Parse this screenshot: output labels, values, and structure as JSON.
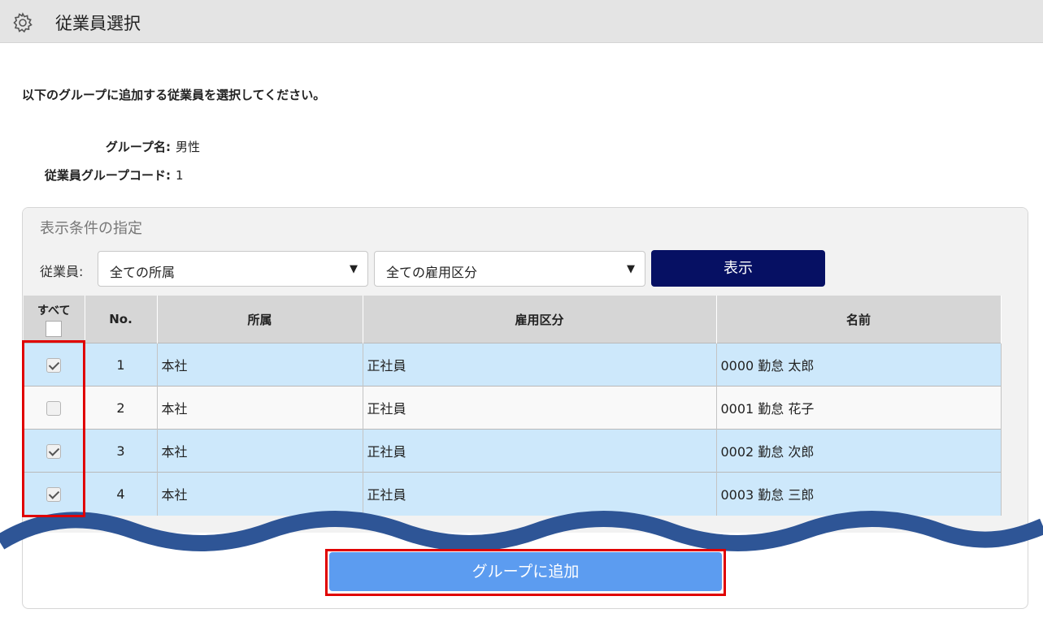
{
  "header": {
    "title": "従業員選択",
    "icon": "gear-icon"
  },
  "instruction": "以下のグループに追加する従業員を選択してください。",
  "group_info": {
    "group_name_label": "グループ名:",
    "group_name_value": "男性",
    "group_code_label": "従業員グループコード:",
    "group_code_value": "1"
  },
  "filter": {
    "panel_title": "表示条件の指定",
    "employee_label": "従業員:",
    "affiliation_select": "全ての所属",
    "employment_select": "全ての雇用区分",
    "show_button": "表示"
  },
  "table": {
    "headers": {
      "all": "すべて",
      "no": "No.",
      "affiliation": "所属",
      "employment": "雇用区分",
      "name": "名前"
    },
    "rows": [
      {
        "checked": true,
        "no": "1",
        "affiliation": "本社",
        "employment": "正社員",
        "name": "0000 勤怠 太郎"
      },
      {
        "checked": false,
        "no": "2",
        "affiliation": "本社",
        "employment": "正社員",
        "name": "0001 勤怠 花子"
      },
      {
        "checked": true,
        "no": "3",
        "affiliation": "本社",
        "employment": "正社員",
        "name": "0002 勤怠 次郎"
      },
      {
        "checked": true,
        "no": "4",
        "affiliation": "本社",
        "employment": "正社員",
        "name": "0003 勤怠 三郎"
      }
    ]
  },
  "add_button": "グループに追加",
  "colors": {
    "selected_row": "#cde8fb",
    "show_button": "#061063",
    "add_button": "#5c9cf0",
    "highlight": "#e00000",
    "wave": "#2e5596"
  }
}
